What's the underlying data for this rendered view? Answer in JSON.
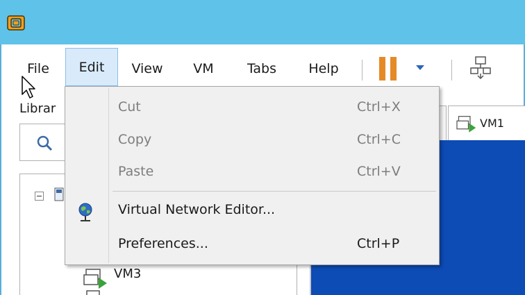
{
  "window": {
    "icons": {
      "app_logo": "vmware-app-icon"
    }
  },
  "menubar": {
    "items": [
      {
        "label": "File"
      },
      {
        "label": "Edit"
      },
      {
        "label": "View"
      },
      {
        "label": "VM"
      },
      {
        "label": "Tabs"
      },
      {
        "label": "Help"
      }
    ],
    "open_menu": "Edit"
  },
  "toolbar": {
    "icons": [
      "pause-icon",
      "dropdown-arrow-icon",
      "network-icon"
    ],
    "pause_color": "#e58a27"
  },
  "edit_menu": {
    "items": [
      {
        "label": "Cut",
        "accel": "Ctrl+X",
        "enabled": false
      },
      {
        "label": "Copy",
        "accel": "Ctrl+C",
        "enabled": false
      },
      {
        "label": "Paste",
        "accel": "Ctrl+V",
        "enabled": false
      },
      {
        "label": "Virtual Network Editor...",
        "accel": "",
        "enabled": true,
        "icon": "globe-icon"
      },
      {
        "label": "Preferences...",
        "accel": "Ctrl+P",
        "enabled": true
      }
    ]
  },
  "library": {
    "label": "Librar",
    "tree": [
      {
        "label": "VM3"
      }
    ]
  },
  "tabs": [
    {
      "label": "VM1"
    }
  ],
  "colors": {
    "titlebar": "#5fc2e9",
    "menu_highlight": "#d9ebfb",
    "console_bg": "#0d4bb5"
  }
}
